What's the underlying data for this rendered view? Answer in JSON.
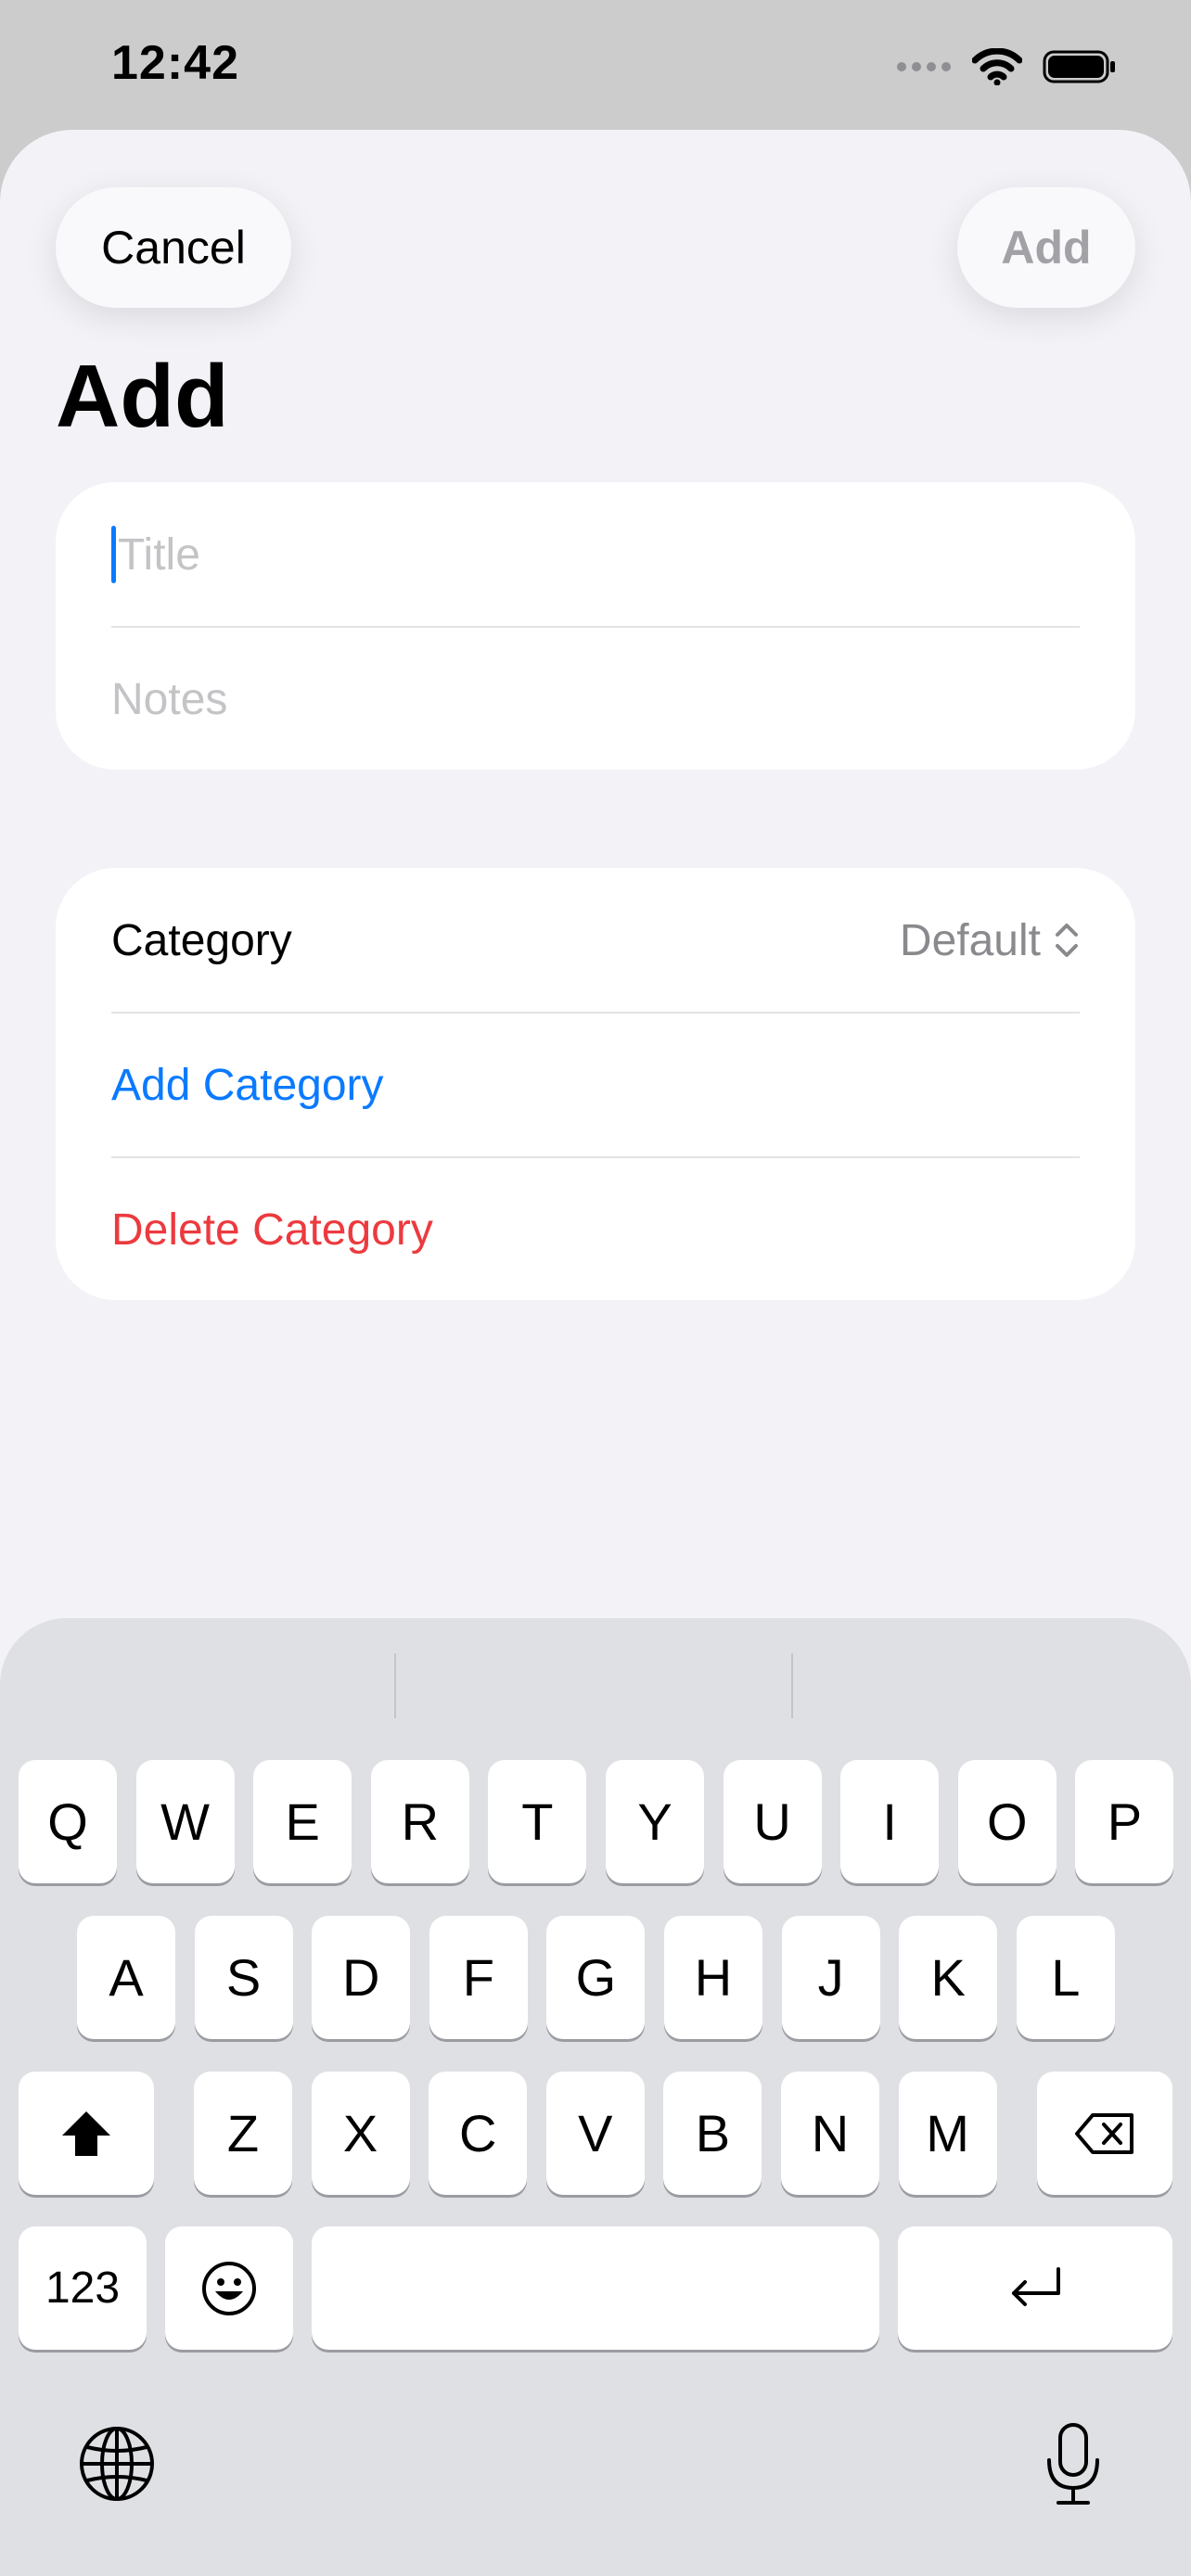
{
  "status": {
    "time": "12:42"
  },
  "nav": {
    "cancel_label": "Cancel",
    "add_label": "Add"
  },
  "page": {
    "title": "Add"
  },
  "form": {
    "title_placeholder": "Title",
    "notes_placeholder": "Notes"
  },
  "category": {
    "label": "Category",
    "value": "Default",
    "add_label": "Add Category",
    "delete_label": "Delete Category"
  },
  "keyboard": {
    "row1": [
      "Q",
      "W",
      "E",
      "R",
      "T",
      "Y",
      "U",
      "I",
      "O",
      "P"
    ],
    "row2": [
      "A",
      "S",
      "D",
      "F",
      "G",
      "H",
      "J",
      "K",
      "L"
    ],
    "row3": [
      "Z",
      "X",
      "C",
      "V",
      "B",
      "N",
      "M"
    ],
    "numbers_label": "123"
  },
  "colors": {
    "accent": "#0a7aff",
    "destructive": "#ec3a3f"
  }
}
